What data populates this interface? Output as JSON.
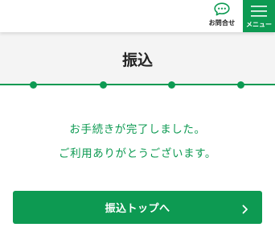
{
  "header": {
    "contact_label": "お問合せ",
    "menu_label": "メニュー"
  },
  "page": {
    "title": "振込"
  },
  "steps": {
    "total": 4
  },
  "message": {
    "line1": "お手続きが完了しました。",
    "line2": "ご利用ありがとうございます。"
  },
  "cta": {
    "label": "振込トップへ"
  },
  "colors": {
    "accent": "#0d9a52",
    "title_band": "#f4f4f4",
    "text": "#222222"
  },
  "icons": {
    "contact": "speech-bubble-icon",
    "menu": "hamburger-icon",
    "cta": "chevron-right-icon"
  }
}
